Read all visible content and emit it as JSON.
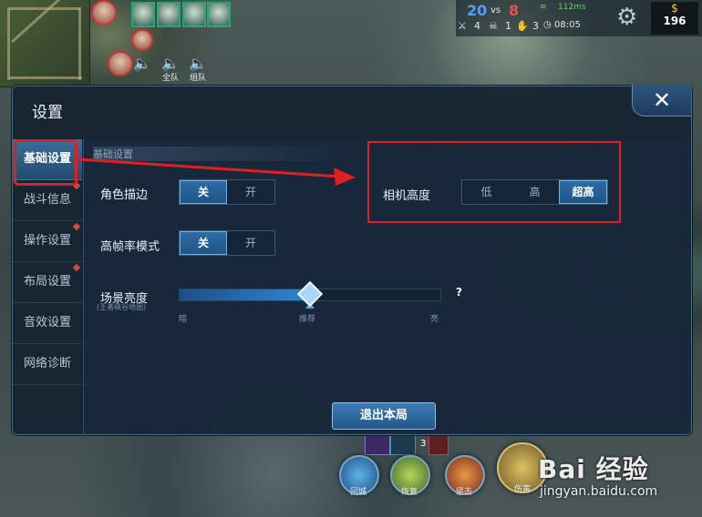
{
  "hud": {
    "voice_all_label": "全队",
    "voice_team_label": "组队",
    "kills_left": "20",
    "vs": "vs",
    "kills_right": "8",
    "ping": "112ms",
    "stat_kills": "4",
    "stat_deaths": "1",
    "stat_assists": "3",
    "time": "08:05",
    "gold": "196",
    "skill_recall": "回城",
    "skill_heal": "恢复",
    "skill_smite": "惩击",
    "skill_attack": "伤害",
    "item_count": "3"
  },
  "panel": {
    "title": "设置",
    "close_label": "✕"
  },
  "sidebar": {
    "items": [
      {
        "label": "基础设置",
        "active": true,
        "dot": false
      },
      {
        "label": "战斗信息",
        "active": false,
        "dot": true
      },
      {
        "label": "操作设置",
        "active": false,
        "dot": true
      },
      {
        "label": "布局设置",
        "active": false,
        "dot": true
      },
      {
        "label": "音效设置",
        "active": false,
        "dot": false
      },
      {
        "label": "网络诊断",
        "active": false,
        "dot": false
      }
    ]
  },
  "settings": {
    "section_header": "基础设置",
    "outline": {
      "label": "角色描边",
      "off": "关",
      "on": "开",
      "selected": "关"
    },
    "high_fps": {
      "label": "高帧率模式",
      "off": "关",
      "on": "开",
      "selected": "关"
    },
    "camera": {
      "label": "相机高度",
      "low": "低",
      "high": "高",
      "ultra": "超高",
      "selected": "超高"
    },
    "brightness": {
      "label": "场景亮度",
      "sublabel": "(王者峡谷地图)",
      "dark": "暗",
      "recommended": "推荐",
      "bright": "亮",
      "value": 0.5,
      "help": "?"
    },
    "exit_button": "退出本局"
  },
  "watermark": {
    "brand": "Bai  经验",
    "url": "jingyan.baidu.com"
  },
  "colors": {
    "annotation": "#e02020",
    "accent": "#2f6ea4",
    "panel_bg": "#142232"
  }
}
